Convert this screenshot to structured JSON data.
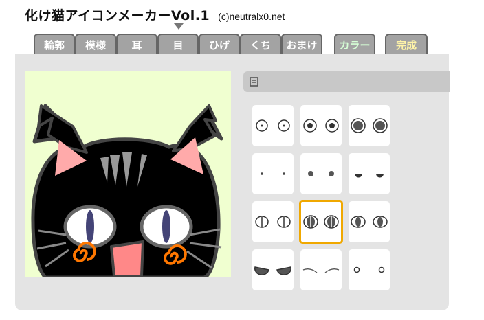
{
  "app": {
    "title": "化け猫アイコンメーカーVol.1",
    "copyright": "(c)neutralx0.net"
  },
  "tabs": [
    {
      "label": "輪郭"
    },
    {
      "label": "模様"
    },
    {
      "label": "耳"
    },
    {
      "label": "目"
    },
    {
      "label": "ひげ"
    },
    {
      "label": "くち"
    },
    {
      "label": "おまけ"
    },
    {
      "label": "カラー"
    },
    {
      "label": "完成"
    }
  ],
  "active_tab": "目",
  "colors": {
    "background_preview": "#f0ffd0",
    "tab_gray": "#a3a3a3",
    "color_tab_text": "#d6ffd6",
    "done_tab_text": "#fff4a8",
    "selection_border": "#f0a800",
    "cat_body": "#000000",
    "cat_ear_inner": "#ffaaaa",
    "cat_stripes": "#999999",
    "cat_swirl": "#ff7700",
    "cat_pupil": "#444477"
  },
  "eye_options": [
    {
      "name": "small-dot-ring"
    },
    {
      "name": "dot-ring"
    },
    {
      "name": "large-dot-ring"
    },
    {
      "name": "tiny-dots"
    },
    {
      "name": "dots"
    },
    {
      "name": "half-dots"
    },
    {
      "name": "slit-open"
    },
    {
      "name": "slit-dark",
      "selected": true
    },
    {
      "name": "oval-pupil"
    },
    {
      "name": "sleepy-half"
    },
    {
      "name": "closed-arcs"
    },
    {
      "name": "small-rings"
    }
  ]
}
